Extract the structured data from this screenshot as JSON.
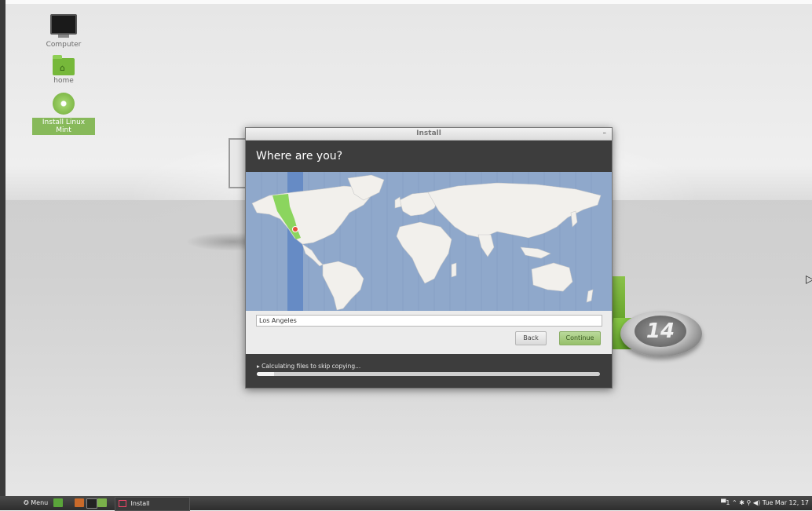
{
  "desktop": {
    "icons": [
      {
        "label": "Computer"
      },
      {
        "label": "home"
      },
      {
        "label": "Install Linux Mint"
      }
    ],
    "logo_text": "14"
  },
  "window": {
    "title": "Install",
    "minimize_glyph": "–",
    "heading": "Where are you?",
    "location_value": "Los Angeles",
    "back_label": "Back",
    "continue_label": "Continue",
    "progress_text": "▸ Calculating files to skip copying...",
    "progress_fraction": 0.05
  },
  "taskbar": {
    "menu_label": "Menu",
    "task_label": "Install",
    "clock": "Tue Mar 12, 17"
  },
  "colors": {
    "accent_green": "#8bc34a",
    "header_dark": "#3d3d3d",
    "ocean": "#8fa8cb"
  }
}
